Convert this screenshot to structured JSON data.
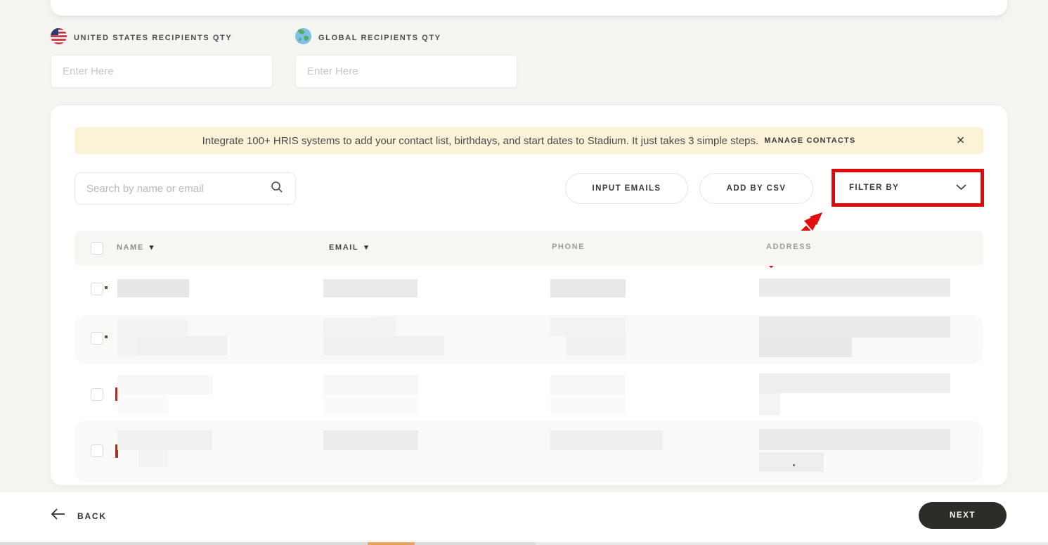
{
  "colors": {
    "page_bg": "#f4f4f1",
    "banner_bg": "#faf3d8",
    "annotation_red": "#dd0909",
    "next_button_bg": "#2d2c29",
    "progress_orange": "#f2a259"
  },
  "quantity_section": {
    "us": {
      "icon": "us-flag",
      "label": "UNITED STATES RECIPIENTS QTY",
      "placeholder": "Enter Here",
      "value": ""
    },
    "global": {
      "icon": "globe",
      "label": "GLOBAL RECIPIENTS QTY",
      "placeholder": "Enter Here",
      "value": ""
    }
  },
  "banner": {
    "message": "Integrate 100+ HRIS systems to add your contact list, birthdays, and start dates to Stadium. It just takes 3 simple steps.",
    "link_label": "MANAGE CONTACTS",
    "close_glyph": "✕"
  },
  "toolbar": {
    "search": {
      "placeholder": "Search by name or email",
      "value": ""
    },
    "buttons": {
      "input_emails": "INPUT EMAILS",
      "add_by_csv": "ADD BY CSV",
      "filter_by": "FILTER BY"
    }
  },
  "annotation": {
    "target": "filter-by-dropdown",
    "style": "red box with red arrow"
  },
  "table": {
    "columns": [
      {
        "label": "NAME",
        "sort_glyph": "▾"
      },
      {
        "label": "EMAIL",
        "sort_glyph": "▾"
      },
      {
        "label": "PHONE"
      },
      {
        "label": "ADDRESS"
      }
    ],
    "row_count": 4,
    "rows_redacted": true
  },
  "footer": {
    "back_label": "BACK",
    "next_label": "NEXT"
  }
}
